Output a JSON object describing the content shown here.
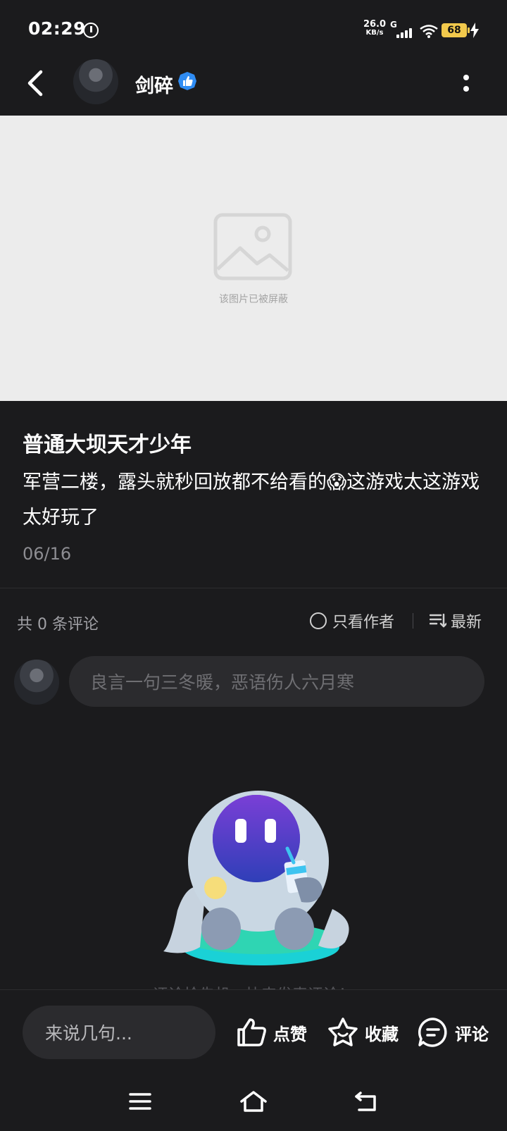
{
  "status_bar": {
    "time": "02:29",
    "net_speed_value": "26.0",
    "net_speed_unit": "KB/s",
    "network_type": "G",
    "battery_level": "68",
    "icons": [
      "clock-icon",
      "signal-icon",
      "wifi-icon",
      "battery-icon",
      "charging-bolt-icon"
    ]
  },
  "header": {
    "author_name": "剑碎",
    "icons": [
      "back-arrow-icon",
      "verified-thumb-icon",
      "more-vertical-icon"
    ]
  },
  "image": {
    "blocked_text": "该图片已被屏蔽",
    "icon": "image-placeholder-icon",
    "background_color": "#ececec"
  },
  "post": {
    "title": "普通大坝天才少年",
    "body": "军营二楼，露头就秒回放都不给看的😱这游戏太这游戏太好玩了",
    "date": "06/16"
  },
  "comments": {
    "count_text": "共 0 条评论",
    "author_only_label": "只看作者",
    "sort_label": "最新",
    "input_placeholder": "良言一句三冬暖，恶语伤人六月寒",
    "empty_text": "评论抢先机，快来发表评论！"
  },
  "action_bar": {
    "say_placeholder": "来说几句...",
    "like_label": "点赞",
    "favorite_label": "收藏",
    "comment_label": "评论"
  },
  "colors": {
    "background": "#1b1b1d",
    "input_bg": "#2b2b2e",
    "verified_blue": "#2f8cf3",
    "battery_yellow": "#f2c94c",
    "mascot_teal": "#1ad1d6",
    "mascot_purple": "#5b2fc4"
  }
}
